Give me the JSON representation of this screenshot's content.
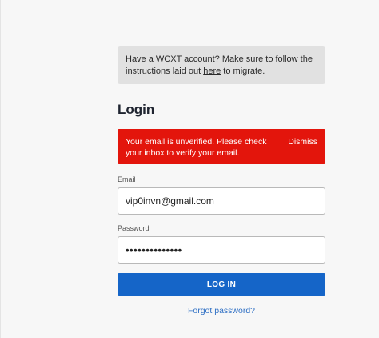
{
  "notice": {
    "text_before": "Have a WCXT account? Make sure to follow the instructions laid out ",
    "link_text": "here",
    "text_after": " to migrate."
  },
  "page_title": "Login",
  "alert": {
    "message": "Your email is unverified. Please check your inbox to verify your email.",
    "dismiss_label": "Dismiss",
    "color": "#e3150c"
  },
  "form": {
    "email_label": "Email",
    "email_value": "vip0invn@gmail.com",
    "password_label": "Password",
    "password_value": "••••••••••••••",
    "login_label": "LOG IN",
    "forgot_label": "Forgot password?",
    "accent_color": "#1565c8"
  }
}
